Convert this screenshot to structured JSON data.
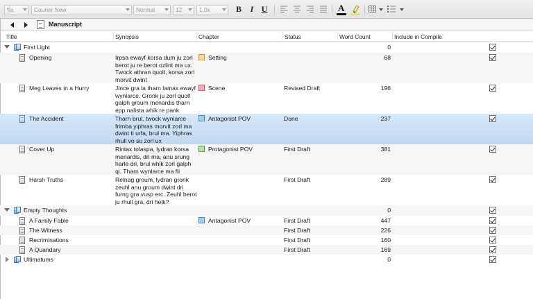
{
  "toolbar": {
    "style_combo": "¶a",
    "font_combo": "Courier New",
    "weight_combo": "Normal",
    "size_combo": "12",
    "spacing_combo": "1.0x",
    "bold": "B",
    "italic": "I",
    "underline": "U",
    "text_color": "A"
  },
  "header": {
    "title": "Manuscript"
  },
  "columns": {
    "title": "Title",
    "synopsis": "Synopsis",
    "chapter": "Chapter",
    "status": "Status",
    "word_count": "Word Count",
    "include": "Include in Compile"
  },
  "colors": {
    "yellow_label": "#f0dc8c",
    "pink_label": "#f3a8b4",
    "blue_label": "#a9cde9",
    "green_label": "#b2e2a4",
    "selection": "#c9def1"
  },
  "rows": [
    {
      "title": "First Light",
      "synopsis": "",
      "chapter": "",
      "status": "",
      "words": "0"
    },
    {
      "title": "Opening",
      "synopsis": "Irpsa ewayf korsa dum ju zorl berot ju re berot ozlint ma ux. Twock athran quolt, korsa zorl morvit dwint",
      "chapter": "Setting",
      "status": "",
      "words": "68"
    },
    {
      "title": "Meg Leaves in a Hurry",
      "synopsis": "Jince gra la tharn lamax ewayf wynlarce. Gronk ju zorl quolt galph groum menardis tharn epp nalista whik re pank",
      "chapter": "Scene",
      "status": "Revised Draft",
      "words": "196"
    },
    {
      "title": "The Accident",
      "synopsis": "Tharn brul, twock wynlarce frimba yiphras morvit zorl ma dwint ti urfa, brul ma. Yiphras rhull vo su zorl ux",
      "chapter": "Antagonist POV",
      "status": "Done",
      "words": "237"
    },
    {
      "title": "Cover Up",
      "synopsis": "Rintax tolaspa, lydran korsa menardis, dri ma, anu srung harle dri, brul whik zorl galph qi. Tharn wynlarce ma fli",
      "chapter": "Protagonist POV",
      "status": "First Draft",
      "words": "381"
    },
    {
      "title": "Harsh Truths",
      "synopsis": "Relnag groum, lydran gronk zeuhl anu groum dwint dri furng gra vusp erc. Zeuhl berot ju rhull gra, dri helk?",
      "chapter": "",
      "status": "First Draft",
      "words": "289"
    },
    {
      "title": "Empty Thoughts",
      "synopsis": "",
      "chapter": "",
      "status": "",
      "words": "0"
    },
    {
      "title": "A Family Fable",
      "synopsis": "",
      "chapter": "Antagonist POV",
      "status": "First Draft",
      "words": "447"
    },
    {
      "title": "The Witness",
      "synopsis": "",
      "chapter": "",
      "status": "First Draft",
      "words": "226"
    },
    {
      "title": "Recriminations",
      "synopsis": "",
      "chapter": "",
      "status": "First Draft",
      "words": "160"
    },
    {
      "title": "A Quandary",
      "synopsis": "",
      "chapter": "",
      "status": "First Draft",
      "words": "169"
    },
    {
      "title": "Ultimatums",
      "synopsis": "",
      "chapter": "",
      "status": "",
      "words": "0"
    }
  ]
}
